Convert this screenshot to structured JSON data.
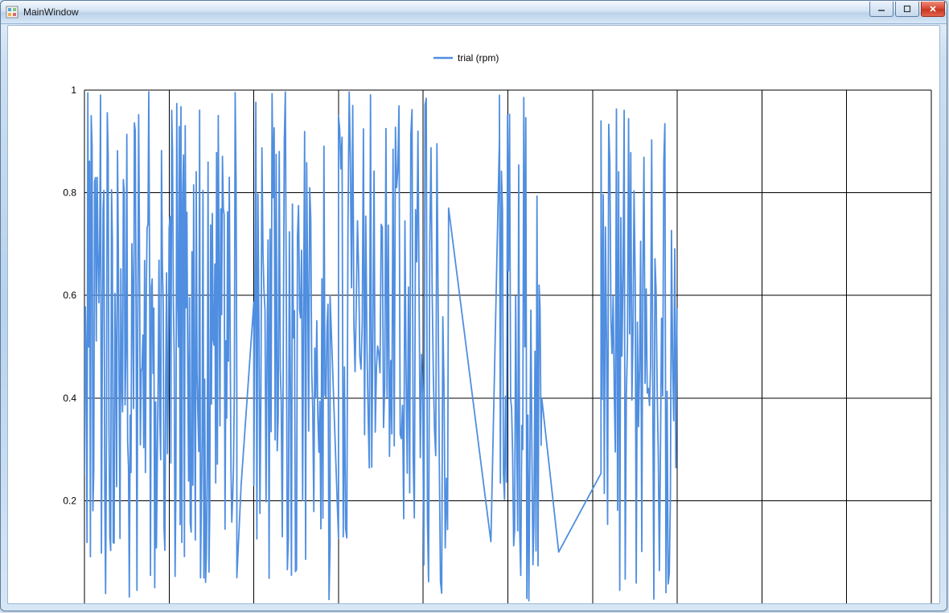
{
  "window": {
    "title": "MainWindow"
  },
  "chart_data": {
    "type": "line",
    "title": "",
    "legend": [
      {
        "name": "trial (rpm)",
        "color": "#4f8ee0"
      }
    ],
    "xlabel": "",
    "ylabel": "",
    "xlim": [
      0,
      1000
    ],
    "ylim": [
      0.0,
      1.0
    ],
    "xticks": [
      0,
      100,
      200,
      300,
      400,
      500,
      600,
      700,
      800,
      900,
      1000
    ],
    "yticks": [
      0.2,
      0.4,
      0.6,
      0.8,
      1.0
    ],
    "yticklabels": [
      "0.2",
      "0.4",
      "0.6",
      "0.8",
      "1"
    ],
    "grid": true,
    "series": [
      {
        "name": "trial (rpm)",
        "x_range": [
          0,
          600
        ],
        "description": "Approximately 600 random samples uniformly distributed between 0 and 1 plotted as a continuous polyline. Data appears as dense noise in several clusters: a dense block from x≈0 to 180, a gap with sparse points around x≈180-200, dense from x≈200-290, a gap around x≈290-300, a moderately dense segment x≈300-440 including a long straight downward segment from ≈(430,0.77) to ≈(480,0.12) and back up, dense cluster x≈490-540, sparse rising straight segment from ≈(560,0.10) to ≈(605,0.94), and a final dense cluster x≈605-700 ending near x≈700.",
        "sample_values": [
          [
            0,
            0.99
          ],
          [
            2,
            0.02
          ],
          [
            4,
            0.97
          ],
          [
            6,
            0.45
          ],
          [
            8,
            0.11
          ],
          [
            10,
            0.88
          ],
          [
            180,
            0.05
          ],
          [
            182,
            0.97
          ],
          [
            185,
            0.23
          ],
          [
            187,
            0.23
          ],
          [
            195,
            0.23
          ],
          [
            200,
            0.95
          ],
          [
            210,
            0.03
          ],
          [
            290,
            0.6
          ],
          [
            300,
            0.95
          ],
          [
            430,
            0.77
          ],
          [
            480,
            0.12
          ],
          [
            490,
            0.99
          ],
          [
            540,
            0.4
          ],
          [
            560,
            0.1
          ],
          [
            605,
            0.94
          ],
          [
            700,
            0.95
          ]
        ]
      }
    ]
  }
}
